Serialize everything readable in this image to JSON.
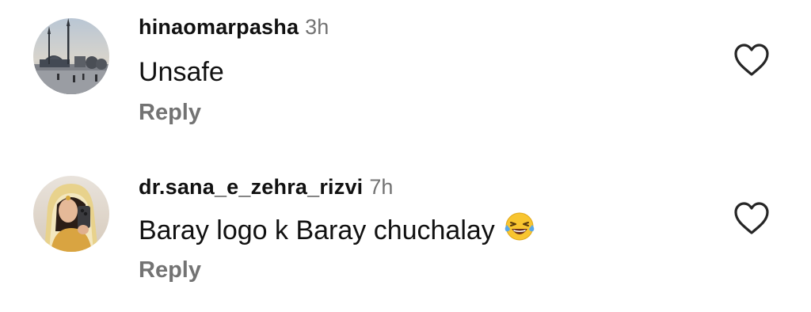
{
  "comments": [
    {
      "username": "hinaomarpasha",
      "time": "3h",
      "text": "Unsafe",
      "reply_label": "Reply",
      "like_icon": "heart-outline-icon",
      "avatar": "avatar-mosque-photo"
    },
    {
      "username": "dr.sana_e_zehra_rizvi",
      "time": "7h",
      "text": "Baray logo k Baray chuchalay",
      "emoji": "face-with-tears-of-joy",
      "reply_label": "Reply",
      "like_icon": "heart-outline-icon",
      "avatar": "avatar-selfie-photo"
    }
  ],
  "colors": {
    "text": "#111111",
    "secondary": "#737373",
    "background": "#ffffff"
  }
}
